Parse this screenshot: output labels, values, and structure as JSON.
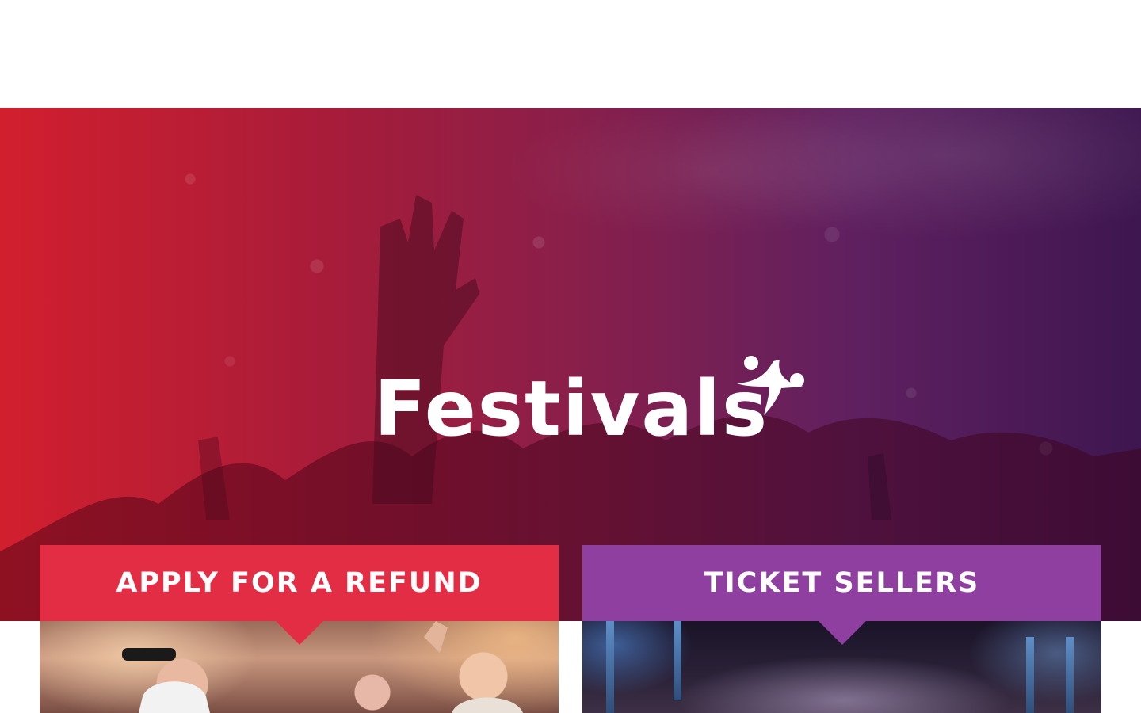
{
  "header": {},
  "hero": {
    "logo_text": "Festivals",
    "logo_mark_icon": "dancing-star-icon",
    "colors": {
      "gradient_start": "#d21f2e",
      "gradient_end": "#3e1650"
    }
  },
  "cards": [
    {
      "title": "APPLY FOR A REFUND",
      "color": "#e32d44",
      "image": "festival-crowd-photo"
    },
    {
      "title": "TICKET SELLERS",
      "color": "#8e3fa0",
      "image": "concert-stage-photo"
    }
  ]
}
